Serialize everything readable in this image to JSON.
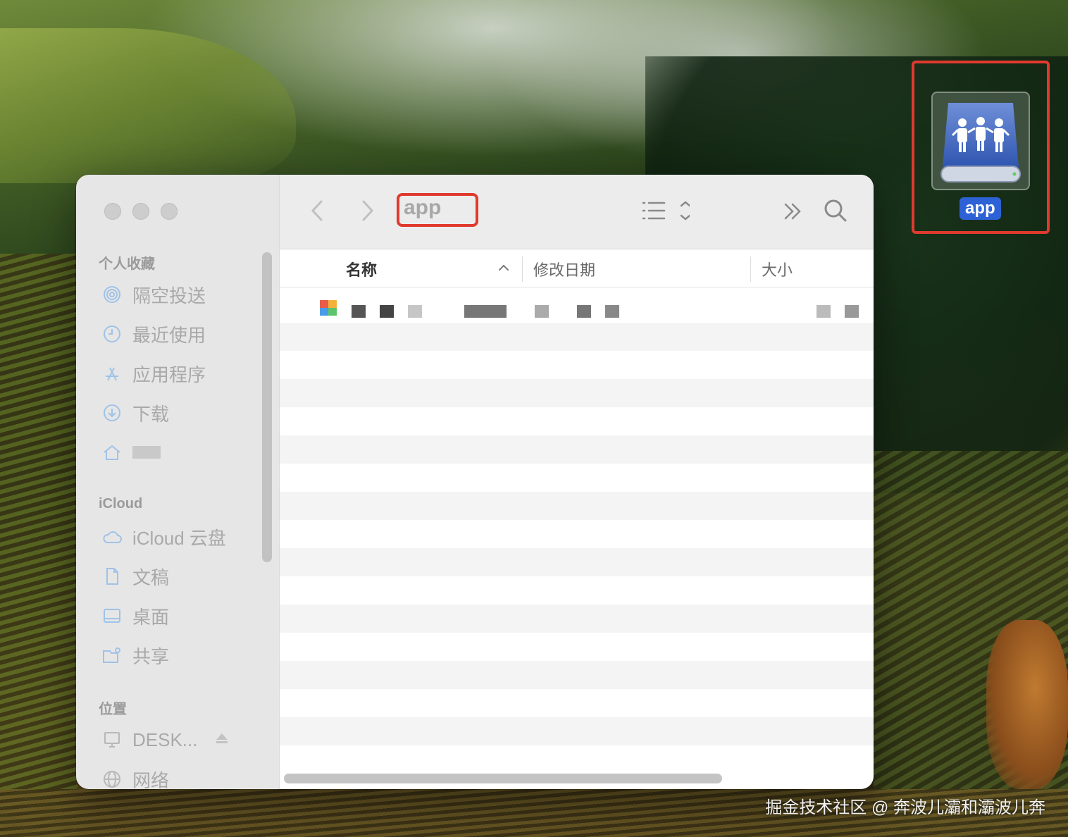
{
  "window": {
    "title": "app",
    "controls": [
      "close",
      "minimize",
      "zoom"
    ],
    "toolbar": {
      "back_icon": "chevron-left-icon",
      "forward_icon": "chevron-right-icon",
      "view_icon": "list-view-icon",
      "more_icon": "double-chevron-right-icon",
      "search_icon": "search-icon"
    }
  },
  "sidebar": {
    "favorites_title": "个人收藏",
    "favorites": [
      {
        "label": "隔空投送",
        "icon": "airdrop-icon"
      },
      {
        "label": "最近使用",
        "icon": "clock-icon"
      },
      {
        "label": "应用程序",
        "icon": "applications-icon"
      },
      {
        "label": "下载",
        "icon": "download-icon"
      },
      {
        "label": "",
        "icon": "home-icon"
      }
    ],
    "icloud_title": "iCloud",
    "icloud": [
      {
        "label": "iCloud 云盘",
        "icon": "cloud-icon"
      },
      {
        "label": "文稿",
        "icon": "document-icon"
      },
      {
        "label": "桌面",
        "icon": "desktop-icon"
      },
      {
        "label": "共享",
        "icon": "shared-folder-icon"
      }
    ],
    "locations_title": "位置",
    "locations": [
      {
        "label": "DESK...",
        "icon": "computer-icon",
        "eject_icon": "eject-icon"
      },
      {
        "label": "网络",
        "icon": "network-icon"
      }
    ]
  },
  "columns": {
    "name": "名称",
    "modified": "修改日期",
    "size": "大小",
    "sort_icon": "chevron-up-icon"
  },
  "files": [
    {
      "icon": "app-file-icon",
      "name": "",
      "redacted": true
    }
  ],
  "desktop": {
    "drive_label": "app",
    "drive_icon": "network-drive-icon"
  },
  "colors": {
    "highlight": "#e03a2f",
    "selection": "#2c62d6"
  },
  "watermark": "掘金技术社区 @ 奔波儿灞和灞波儿奔"
}
